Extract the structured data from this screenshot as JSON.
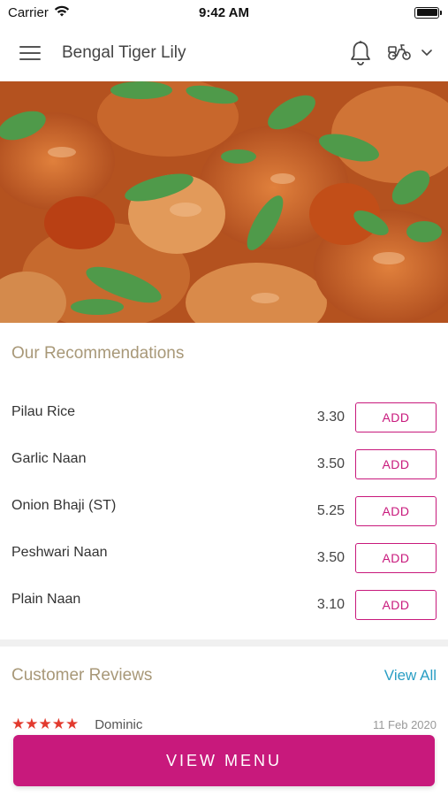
{
  "status_bar": {
    "carrier": "Carrier",
    "time": "9:42 AM",
    "wifi_icon": "wifi-icon",
    "battery_icon": "battery-icon"
  },
  "header": {
    "title": "Bengal Tiger Lily",
    "menu_icon": "hamburger-icon",
    "notification_icon": "bell-icon",
    "delivery_icon": "scooter-icon",
    "dropdown_icon": "chevron-down-icon"
  },
  "hero": {
    "description_icon": "food-photo"
  },
  "recommendations": {
    "title": "Our Recommendations",
    "items": [
      {
        "name": "Pilau Rice",
        "price": "3.30",
        "action": "ADD"
      },
      {
        "name": "Garlic Naan",
        "price": "3.50",
        "action": "ADD"
      },
      {
        "name": "Onion Bhaji (ST)",
        "price": "5.25",
        "action": "ADD"
      },
      {
        "name": "Peshwari Naan",
        "price": "3.50",
        "action": "ADD"
      },
      {
        "name": "Plain Naan",
        "price": "3.10",
        "action": "ADD"
      }
    ]
  },
  "reviews": {
    "title": "Customer Reviews",
    "view_all_label": "View All",
    "first_review": {
      "rating": 5,
      "stars": "★★★★★",
      "reviewer": "Dominic",
      "date": "11 Feb 2020"
    }
  },
  "footer": {
    "view_menu_label": "VIEW MENU"
  },
  "colors": {
    "accent": "#c8197c",
    "section_title": "#a89878",
    "link": "#2a9ec4",
    "star": "#e23a2e"
  }
}
